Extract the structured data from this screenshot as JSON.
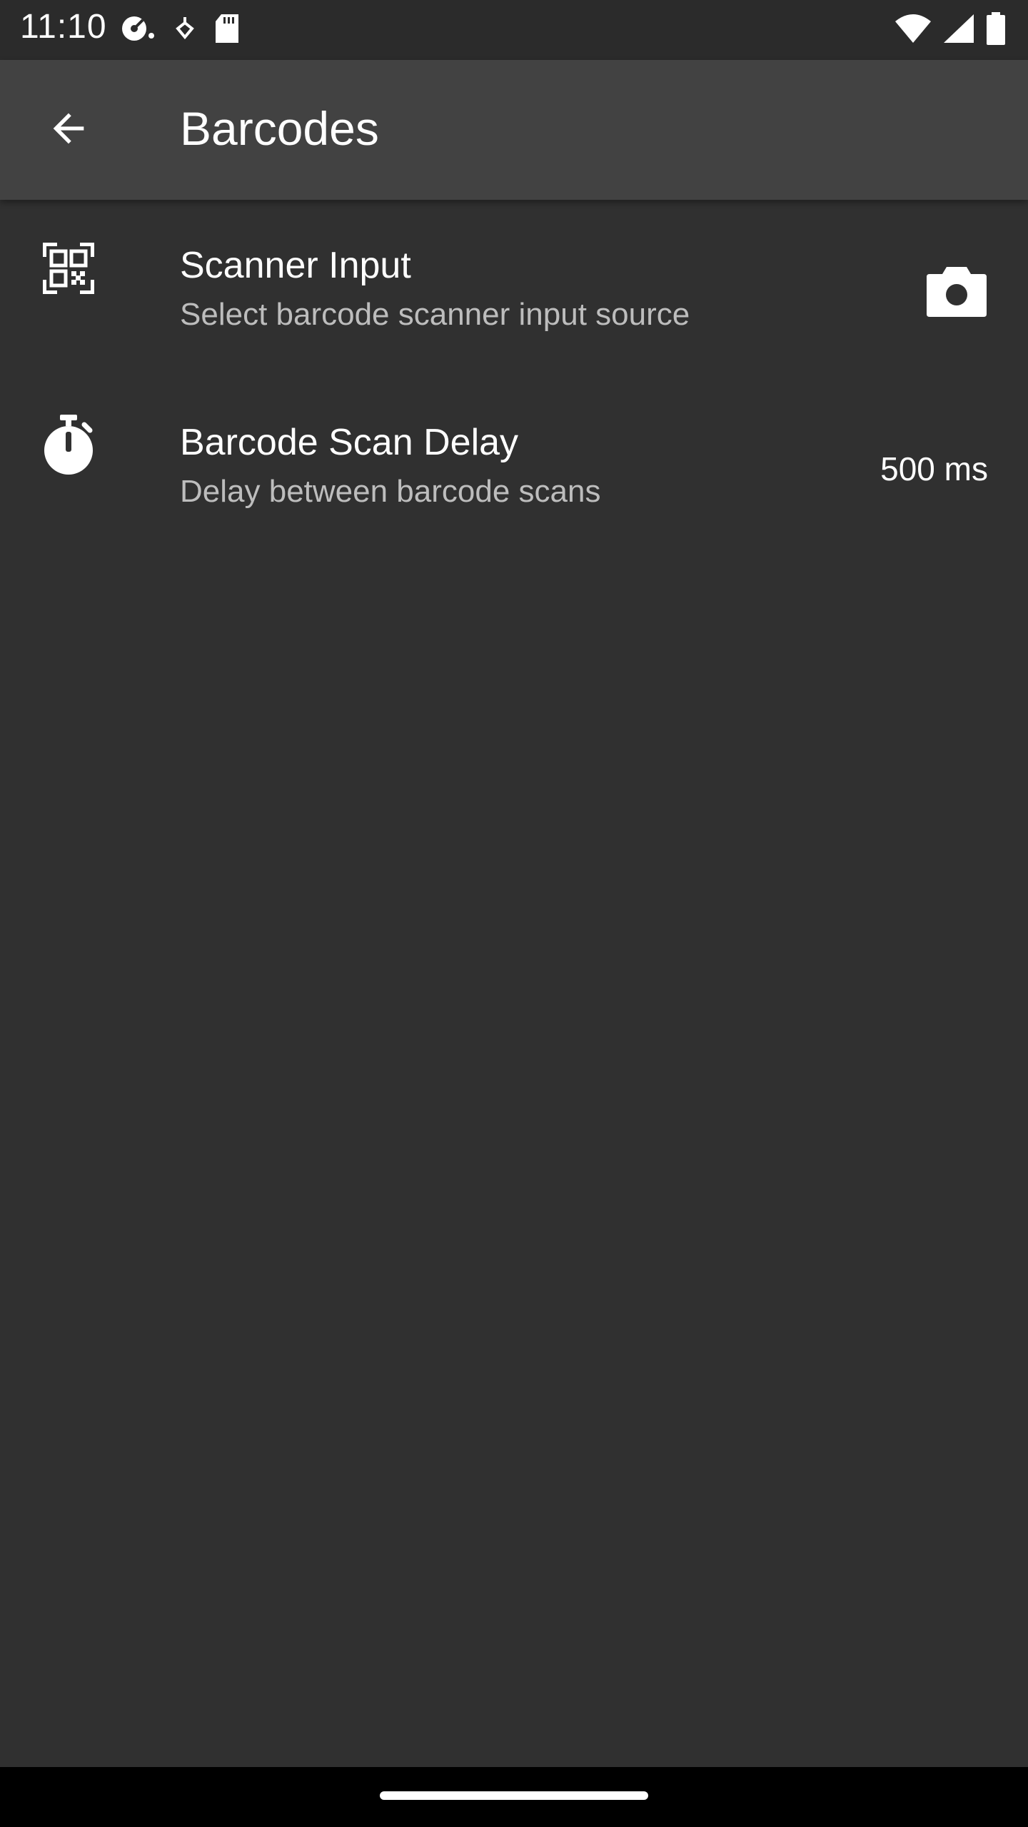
{
  "status_bar": {
    "time": "11:10",
    "left_icons": [
      "media-icon",
      "location-icon",
      "sd-card-icon"
    ],
    "right_icons": [
      "wifi-icon",
      "cell-signal-icon",
      "battery-icon"
    ]
  },
  "app_bar": {
    "back_icon": "arrow-back-icon",
    "title": "Barcodes"
  },
  "preferences": [
    {
      "icon": "qr-code-icon",
      "title": "Scanner Input",
      "summary": "Select barcode scanner input source",
      "widget_icon": "camera-icon"
    },
    {
      "icon": "timer-icon",
      "title": "Barcode Scan Delay",
      "summary": "Delay between barcode scans",
      "value": "500 ms"
    }
  ],
  "colors": {
    "background": "#303030",
    "app_bar": "#424242",
    "status_bar": "#2b2b2b",
    "primary_text": "#ffffff",
    "secondary_text": "#bdbdbd",
    "nav_bar": "#000000"
  }
}
